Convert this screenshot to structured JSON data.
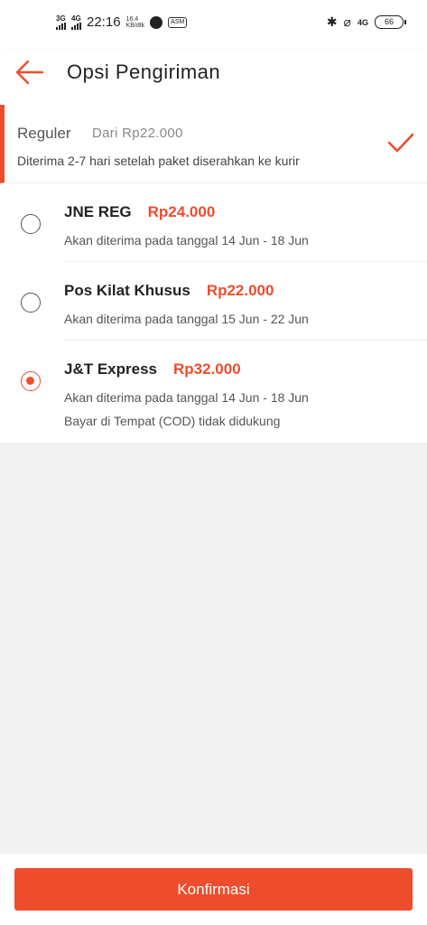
{
  "status_bar": {
    "network_1": "3G",
    "network_2": "4G",
    "time": "22:16",
    "speed_value": "16.4",
    "speed_unit": "KB/dtk",
    "small_badge": "ASM",
    "network_3": "4G",
    "battery": "66"
  },
  "header": {
    "title": "Opsi Pengiriman"
  },
  "group": {
    "name": "Reguler",
    "price_from": "Dari Rp22.000",
    "description": "Diterima 2-7 hari setelah paket diserahkan ke kurir",
    "selected": true
  },
  "options": [
    {
      "name": "JNE REG",
      "price": "Rp24.000",
      "eta": "Akan diterima pada tanggal 14 Jun - 18 Jun",
      "note": "",
      "selected": false
    },
    {
      "name": "Pos Kilat Khusus",
      "price": "Rp22.000",
      "eta": "Akan diterima pada tanggal 15 Jun - 22 Jun",
      "note": "",
      "selected": false
    },
    {
      "name": "J&T Express",
      "price": "Rp32.000",
      "eta": "Akan diterima pada tanggal 14 Jun - 18 Jun",
      "note": "Bayar di Tempat (COD) tidak didukung",
      "selected": true
    }
  ],
  "footer": {
    "confirm_label": "Konfirmasi"
  },
  "colors": {
    "accent": "#ee4d2d",
    "background": "#f2f2f2"
  }
}
